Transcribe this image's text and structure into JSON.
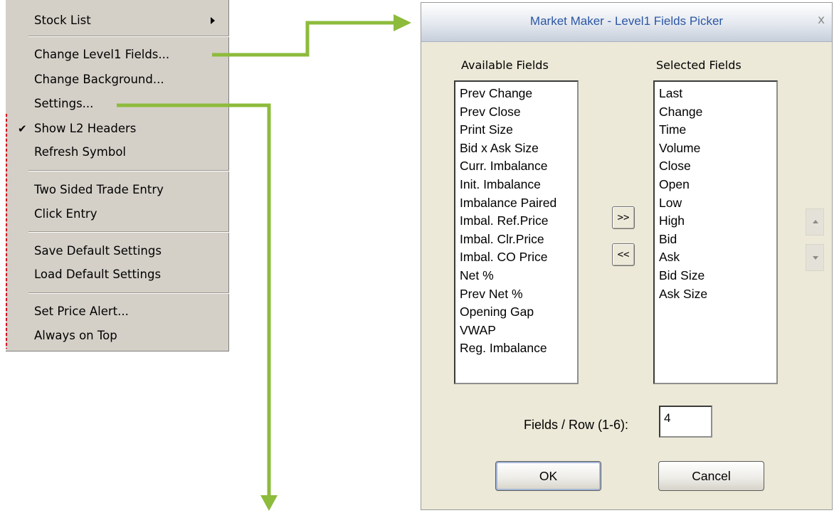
{
  "menu": {
    "items": [
      {
        "label": "Stock List",
        "submenu": true
      },
      {
        "label": "Change Level1 Fields..."
      },
      {
        "label": "Change Background..."
      },
      {
        "label": "Settings..."
      },
      {
        "label": "Show L2 Headers",
        "checked": true,
        "check_glyph": "✔"
      },
      {
        "label": "Refresh Symbol"
      },
      {
        "label": "Two Sided Trade Entry"
      },
      {
        "label": "Click Entry"
      },
      {
        "label": "Save Default Settings"
      },
      {
        "label": "Load Default Settings"
      },
      {
        "label": "Set Price Alert..."
      },
      {
        "label": "Always on Top"
      }
    ]
  },
  "annotation": {
    "arrow_color": "#8dbb3c"
  },
  "dialog": {
    "title": "Market Maker - Level1 Fields Picker",
    "close_glyph": "x",
    "available_label": "Available Fields",
    "selected_label": "Selected Fields",
    "available_fields": [
      "Prev Change",
      "Prev Close",
      "Print Size",
      "Bid x Ask Size",
      "Curr. Imbalance",
      "Init. Imbalance",
      "Imbalance Paired",
      "Imbal. Ref.Price",
      "Imbal. Clr.Price",
      "Imbal. CO Price",
      "Net %",
      "Prev Net %",
      "Opening Gap",
      "VWAP",
      "Reg. Imbalance"
    ],
    "selected_fields": [
      "Last",
      "Change",
      "Time",
      "Volume",
      "Close",
      "Open",
      "Low",
      "High",
      "Bid",
      "Ask",
      "Bid Size",
      "Ask Size"
    ],
    "add_button": ">>",
    "remove_button": "<<",
    "rows_label": "Fields / Row (1-6):",
    "rows_value": "4",
    "ok_label": "OK",
    "cancel_label": "Cancel"
  }
}
